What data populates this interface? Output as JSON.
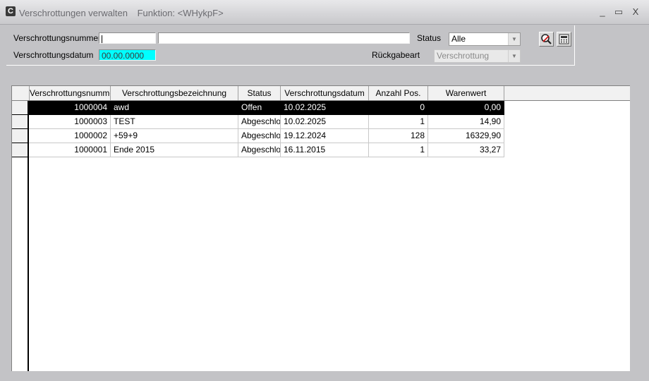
{
  "window": {
    "title": "Verschrottungen verwalten",
    "function": "Funktion: <WHykpF>",
    "controls": {
      "minimize": "_",
      "maximize": "▭",
      "close": "X"
    }
  },
  "filter": {
    "number_label": "Verschrottungsnummer",
    "number_value": "",
    "description_value": "",
    "date_label": "Verschrottungsdatum",
    "date_value": "00.00.0000",
    "status_label": "Status",
    "status_value": "Alle",
    "return_type_label": "Rückgabeart",
    "return_type_value": "Verschrottung"
  },
  "toolbar": {
    "search_icon": "search-icon",
    "calculator_icon": "calculator-icon"
  },
  "table": {
    "columns": [
      "Verschrottungsnummer",
      "Verschrottungsbezeichnung",
      "Status",
      "Verschrottungsdatum",
      "Anzahl Pos.",
      "Warenwert"
    ],
    "rows": [
      [
        "1000004",
        "awd",
        "Offen",
        "10.02.2025",
        "0",
        "0,00"
      ],
      [
        "1000003",
        "TEST",
        "Abgeschlo",
        "10.02.2025",
        "1",
        "14,90"
      ],
      [
        "1000002",
        "+59+9",
        "Abgeschlo",
        "19.12.2024",
        "128",
        "16329,90"
      ],
      [
        "1000001",
        "Ende 2015",
        "Abgeschlo",
        "16.11.2015",
        "1",
        "33,27"
      ]
    ],
    "selected_row": 0
  }
}
